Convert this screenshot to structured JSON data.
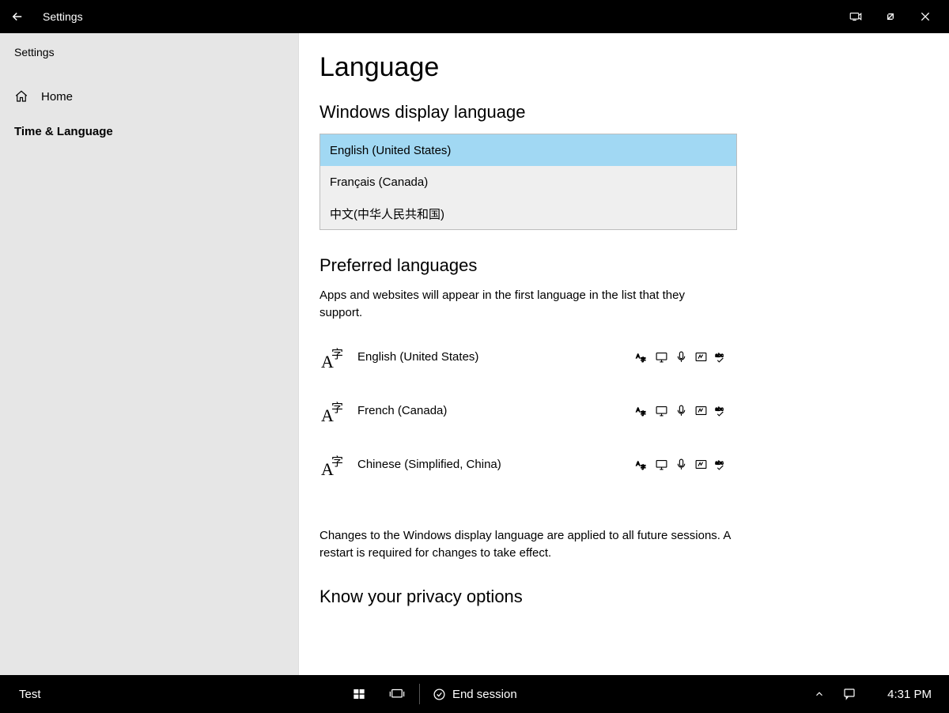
{
  "titlebar": {
    "title": "Settings"
  },
  "sidebar": {
    "crumbs": "Settings",
    "home_label": "Home",
    "category_label": "Time & Language"
  },
  "main": {
    "page_title": "Language",
    "display_heading": "Windows display language",
    "display_options": [
      "English (United States)",
      "Français (Canada)",
      "中文(中华人民共和国)"
    ],
    "preferred_heading": "Preferred languages",
    "preferred_desc": "Apps and websites will appear in the first language in the list that they support.",
    "preferred_items": [
      "English (United States)",
      "French (Canada)",
      "Chinese (Simplified, China)"
    ],
    "note": "Changes to the Windows display language are applied to all future sessions. A restart is required for changes to take effect.",
    "privacy_heading": "Know your privacy options"
  },
  "taskbar": {
    "user": "Test",
    "end_session": "End session",
    "clock": "4:31 PM"
  }
}
